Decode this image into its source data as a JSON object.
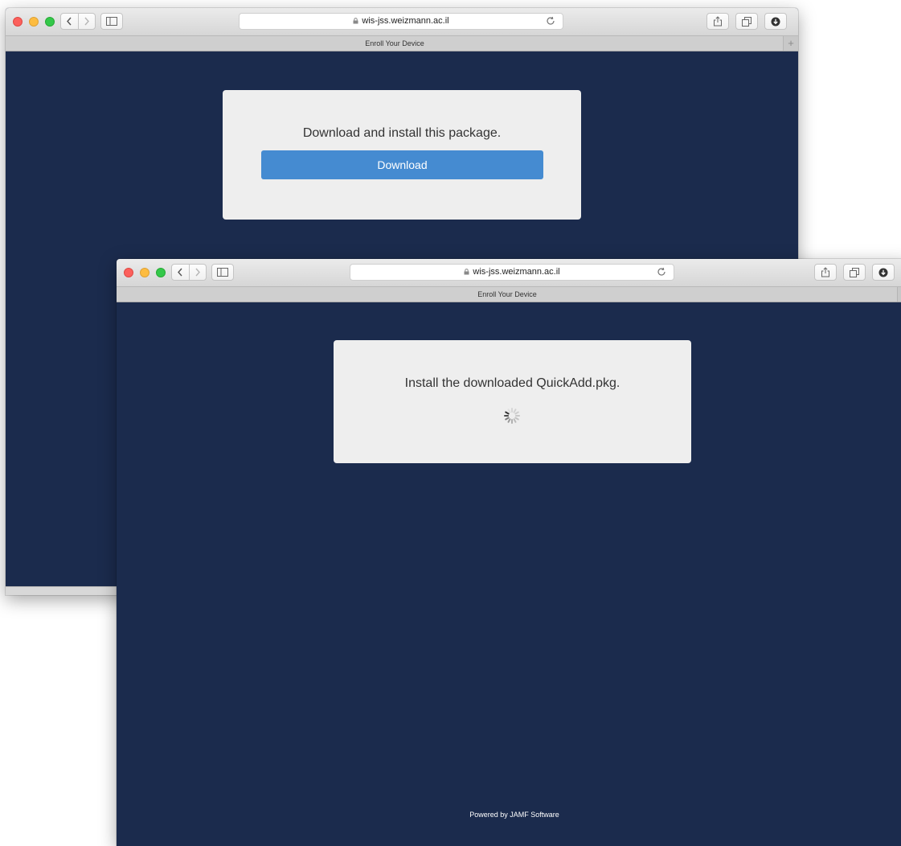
{
  "windows": {
    "back": {
      "address": "wis-jss.weizmann.ac.il",
      "tab_title": "Enroll Your Device",
      "tab_add": "+",
      "card_message": "Download and install this package.",
      "download_button": "Download"
    },
    "front": {
      "address": "wis-jss.weizmann.ac.il",
      "tab_title": "Enroll Your Device",
      "tab_add": "+",
      "card_message": "Install the downloaded QuickAdd.pkg.",
      "footer": "Powered by JAMF Software"
    }
  },
  "icons": {
    "back": "chevron-left-icon",
    "forward": "chevron-right-icon",
    "sidebar": "sidebar-icon",
    "lock": "lock-icon",
    "reload": "reload-icon",
    "share": "share-icon",
    "tabs": "tabs-icon",
    "downloads": "download-icon",
    "spinner": "spinner-icon"
  },
  "colors": {
    "page_background": "#1b2b4d",
    "card_background": "#eeeeee",
    "download_button": "#458bd1",
    "traffic_close": "#fc605c",
    "traffic_minimize": "#fdbc40",
    "traffic_maximize": "#34c84a"
  }
}
